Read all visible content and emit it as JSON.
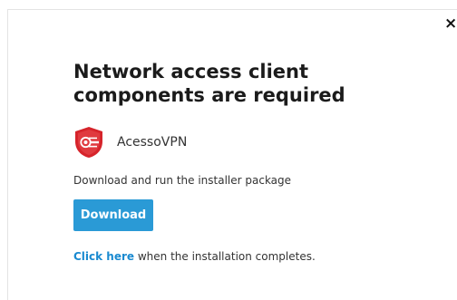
{
  "dialog": {
    "close_label": "×",
    "title": "Network access client components are required",
    "app": {
      "name": "AcessoVPN",
      "icon": "shield-vpn-icon",
      "icon_color": "#d6242b"
    },
    "instruction": "Download and run the installer package",
    "download_label": "Download",
    "link_text": "Click here",
    "completion_text": " when the installation completes."
  },
  "colors": {
    "accent": "#2a9ad6",
    "link": "#1a8ad0"
  }
}
